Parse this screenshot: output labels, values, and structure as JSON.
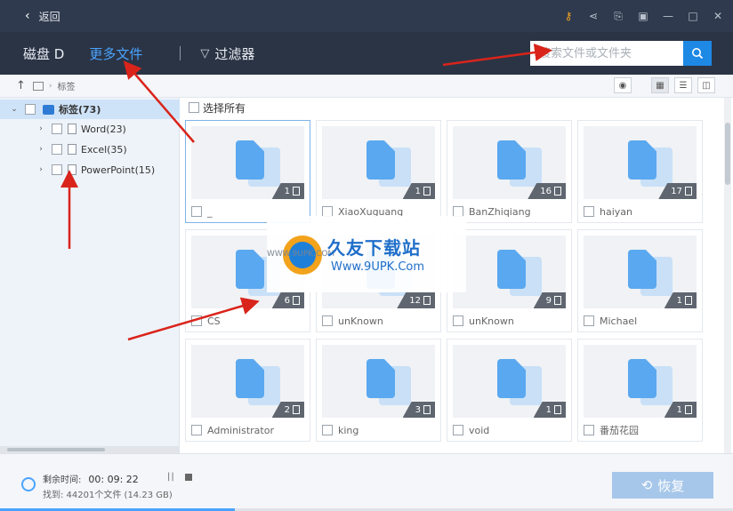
{
  "titlebar": {
    "back_label": "返回"
  },
  "nav": {
    "disk": "磁盘 D",
    "more_files": "更多文件",
    "filter": "过滤器"
  },
  "search": {
    "placeholder": "搜索文件或文件夹"
  },
  "breadcrumb": {
    "current": "标签"
  },
  "tree": {
    "root": "标签(73)",
    "children": [
      "Word(23)",
      "Excel(35)",
      "PowerPoint(15)"
    ]
  },
  "main": {
    "select_all": "选择所有",
    "cards": [
      {
        "count": "1",
        "label": "_"
      },
      {
        "count": "1",
        "label": "XiaoXuguang"
      },
      {
        "count": "16",
        "label": "BanZhiqiang"
      },
      {
        "count": "17",
        "label": "haiyan"
      },
      {
        "count": "6",
        "label": "CS"
      },
      {
        "count": "12",
        "label": "unKnown"
      },
      {
        "count": "9",
        "label": "unKnown"
      },
      {
        "count": "1",
        "label": "Michael"
      },
      {
        "count": "2",
        "label": "Administrator"
      },
      {
        "count": "3",
        "label": "king"
      },
      {
        "count": "1",
        "label": "void"
      },
      {
        "count": "1",
        "label": "番茄花园"
      }
    ]
  },
  "watermark": {
    "title": "久友下载站",
    "url": "Www.9UPK.Com",
    "small": "WWW.9UPK.COM"
  },
  "footer": {
    "remaining_label": "剩余时间:",
    "remaining_value": "00: 09: 22",
    "found": "找到: 44201个文件 (14.23 GB)",
    "restore": "恢复",
    "progress": 0.32
  },
  "colors": {
    "accent": "#1e88e5",
    "titlebar": "#2f3a4e",
    "navbar": "#2b3445",
    "arrow": "#d9241b"
  }
}
